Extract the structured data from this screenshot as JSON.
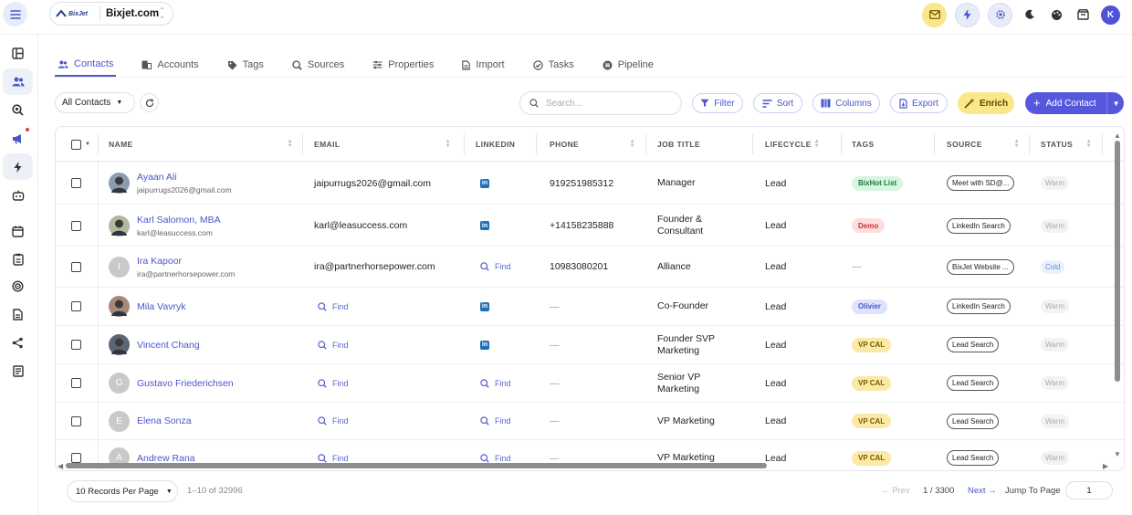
{
  "brand": {
    "logo_text": "BixJet",
    "name": "Bixjet.com"
  },
  "colors": {
    "accent": "#4a56c9",
    "primary_button": "#5558dc",
    "enrich": "#fbe68a"
  },
  "topbar_icons": [
    "mail-icon",
    "bolt-icon",
    "settings-icon",
    "moon-icon",
    "palette-icon",
    "storefront-icon"
  ],
  "user_avatar": "K",
  "sidebar": [
    {
      "icon": "dashboard-icon"
    },
    {
      "icon": "contacts-icon",
      "active": true
    },
    {
      "icon": "search-target-icon"
    },
    {
      "icon": "megaphone-icon",
      "badge": true
    },
    {
      "icon": "bolt-icon"
    },
    {
      "icon": "bot-icon"
    },
    {
      "icon": "calendar-icon"
    },
    {
      "icon": "clipboard-icon"
    },
    {
      "icon": "target-icon"
    },
    {
      "icon": "document-icon"
    },
    {
      "icon": "share-icon"
    },
    {
      "icon": "report-icon"
    }
  ],
  "tabs": [
    {
      "label": "Contacts",
      "icon": "contacts-icon",
      "active": true
    },
    {
      "label": "Accounts",
      "icon": "building-icon"
    },
    {
      "label": "Tags",
      "icon": "tag-icon"
    },
    {
      "label": "Sources",
      "icon": "magnify-icon"
    },
    {
      "label": "Properties",
      "icon": "sliders-icon"
    },
    {
      "label": "Import",
      "icon": "file-icon"
    },
    {
      "label": "Tasks",
      "icon": "check-circle-icon"
    },
    {
      "label": "Pipeline",
      "icon": "pipeline-icon"
    }
  ],
  "toolbar": {
    "view_select": "All Contacts",
    "search_placeholder": "Search...",
    "filter": "Filter",
    "sort": "Sort",
    "columns": "Columns",
    "export": "Export",
    "enrich": "Enrich",
    "add_contact": "Add Contact"
  },
  "columns": [
    "NAME",
    "EMAIL",
    "LINKEDIN",
    "PHONE",
    "JOB TITLE",
    "LIFECYCLE",
    "TAGS",
    "SOURCE",
    "STATUS"
  ],
  "find_label": "Find",
  "rows": [
    {
      "name": "Ayaan Ali",
      "sub_email": "jaipurrugs2026@gmail.com",
      "email": "jaipurrugs2026@gmail.com",
      "linkedin": "icon",
      "phone": "919251985312",
      "job": "Manager",
      "lifecycle": "Lead",
      "tag": "BixHot List",
      "tag_color": "green",
      "source": "Meet with SD@...",
      "status": "Warm",
      "avatar": "photo"
    },
    {
      "name": "Karl Salomon, MBA",
      "sub_email": "karl@leasuccess.com",
      "email": "karl@leasuccess.com",
      "linkedin": "icon",
      "phone": "+14158235888",
      "job": "Founder & Consultant",
      "lifecycle": "Lead",
      "tag": "Demo",
      "tag_color": "red",
      "source": "LinkedIn Search",
      "status": "Warm",
      "avatar": "photo"
    },
    {
      "name": "Ira Kapoor",
      "sub_email": "ira@partnerhorsepower.com",
      "email": "ira@partnerhorsepower.com",
      "linkedin": "find",
      "phone": "10983080201",
      "job": "Alliance",
      "lifecycle": "Lead",
      "tag": "—",
      "tag_color": "",
      "source": "BixJet Website ...",
      "status": "Cold",
      "avatar": "I"
    },
    {
      "name": "Mila Vavryk",
      "sub_email": "",
      "email": "find",
      "linkedin": "icon",
      "phone": "—",
      "job": "Co-Founder",
      "lifecycle": "Lead",
      "tag": "Olivier",
      "tag_color": "purple",
      "source": "LinkedIn Search",
      "status": "Warm",
      "avatar": "photo"
    },
    {
      "name": "Vincent Chang",
      "sub_email": "",
      "email": "find",
      "linkedin": "icon",
      "phone": "—",
      "job": "Founder SVP Marketing",
      "lifecycle": "Lead",
      "tag": "VP CAL",
      "tag_color": "yellow",
      "source": "Lead Search",
      "status": "Warm",
      "avatar": "photo"
    },
    {
      "name": "Gustavo Friederichsen",
      "sub_email": "",
      "email": "find",
      "linkedin": "find",
      "phone": "—",
      "job": "Senior VP Marketing",
      "lifecycle": "Lead",
      "tag": "VP CAL",
      "tag_color": "yellow",
      "source": "Lead Search",
      "status": "Warm",
      "avatar": "G"
    },
    {
      "name": "Elena Sonza",
      "sub_email": "",
      "email": "find",
      "linkedin": "find",
      "phone": "—",
      "job": "VP Marketing",
      "lifecycle": "Lead",
      "tag": "VP CAL",
      "tag_color": "yellow",
      "source": "Lead Search",
      "status": "Warm",
      "avatar": "E"
    },
    {
      "name": "Andrew Rana",
      "sub_email": "",
      "email": "find",
      "linkedin": "find",
      "phone": "—",
      "job": "VP Marketing",
      "lifecycle": "Lead",
      "tag": "VP CAL",
      "tag_color": "yellow",
      "source": "Lead Search",
      "status": "Warm",
      "avatar": "A"
    }
  ],
  "footer": {
    "per_page": "10 Records Per Page",
    "range": "1–10 of 32996",
    "prev": "← Prev",
    "page": "1 / 3300",
    "next": "Next →",
    "jump_label": "Jump To Page",
    "jump_value": "1"
  }
}
